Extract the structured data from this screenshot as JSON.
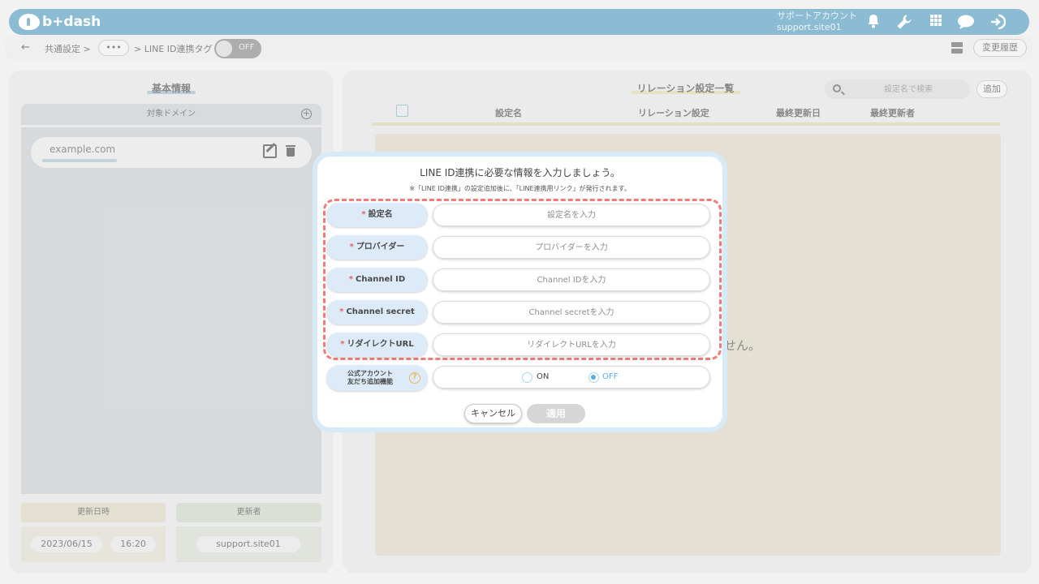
{
  "header": {
    "logo_text": "b+dash",
    "account_label": "サポートアカウント",
    "account_id": "support.site01",
    "icons": [
      "bell-icon",
      "wrench-icon",
      "grid-icon",
      "chat-icon",
      "logout-icon"
    ]
  },
  "breadcrumb": {
    "back": "←",
    "item1": "共通設定 >",
    "ellipsis": "•••",
    "item2": "> LINE ID連携タグ",
    "toggle_label": "OFF",
    "history_button": "変更履歴"
  },
  "left_panel": {
    "title": "基本情報",
    "domain_header": "対象ドメイン",
    "domains": [
      "example.com"
    ],
    "date_header": "更新日時",
    "updater_header": "更新者",
    "date": "2023/06/15",
    "time": "16:20",
    "updater": "support.site01"
  },
  "right_panel": {
    "title": "リレーション設定一覧",
    "search_placeholder": "設定名で検索",
    "add_button": "追加",
    "columns": [
      "設定名",
      "リレーション設定",
      "最終更新日",
      "最終更新者"
    ],
    "empty_message_partial": "せん。"
  },
  "modal": {
    "title": "LINE ID連携に必要な情報を入力しましょう。",
    "note": "※「LINE ID連携」の設定追加後に、「LINE連携用リンク」が発行されます。",
    "required_mark": "*",
    "fields": [
      {
        "label": "設定名",
        "placeholder": "設定名を入力"
      },
      {
        "label": "プロバイダー",
        "placeholder": "プロバイダーを入力"
      },
      {
        "label": "Channel ID",
        "placeholder": "Channel IDを入力"
      },
      {
        "label": "Channel secret",
        "placeholder": "Channel secretを入力"
      },
      {
        "label": "リダイレクトURL",
        "placeholder": "リダイレクトURLを入力"
      }
    ],
    "official_label_line1": "公式アカウント",
    "official_label_line2": "友だち追加機能",
    "help_symbol": "?",
    "radio_on": "ON",
    "radio_off": "OFF",
    "radio_selected": "OFF",
    "cancel_button": "キャンセル",
    "apply_button": "適用"
  },
  "colors": {
    "header_bar": "#5a9fc0",
    "dashed_highlight": "#f07b7b",
    "field_label_bg": "#dcebf7",
    "radio_selected_text": "#5aaee0"
  }
}
